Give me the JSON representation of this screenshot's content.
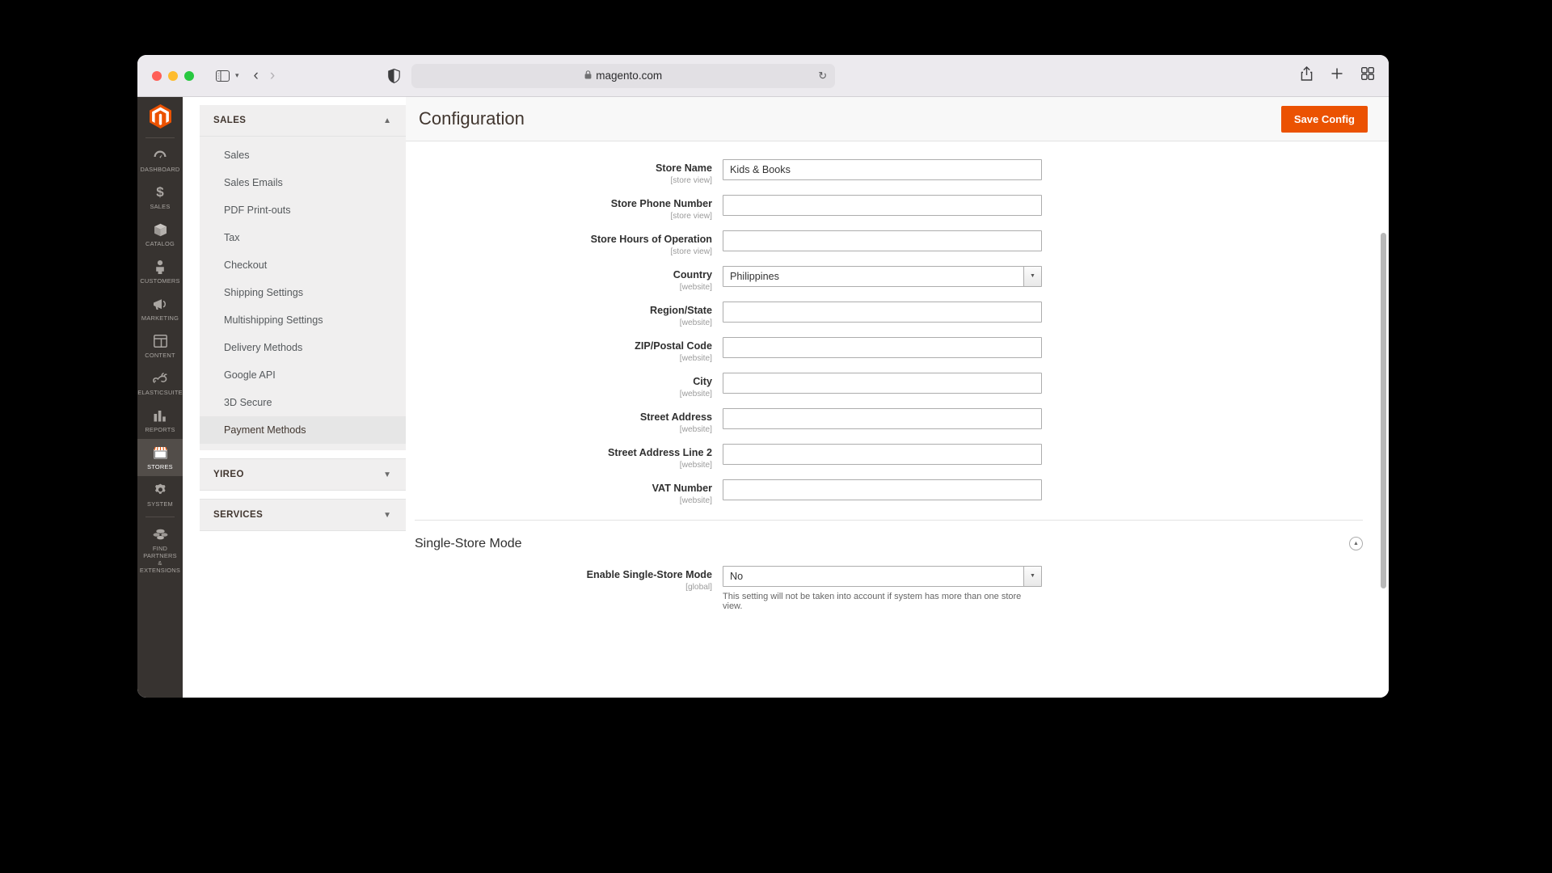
{
  "browser": {
    "url": "magento.com",
    "lock_icon": "lock-icon",
    "shield_icon": "shield-icon",
    "sidebar_icon": "sidebar-toggle-icon",
    "back_icon": "back-arrow-icon",
    "forward_icon": "forward-arrow-icon",
    "reload_icon": "reload-icon",
    "share_icon": "share-icon",
    "newtab_icon": "new-tab-icon",
    "tabgroup_icon": "tab-overview-icon"
  },
  "header": {
    "title": "Configuration",
    "save_label": "Save Config",
    "accent_color": "#eb5202"
  },
  "rail": {
    "logo_icon": "magento-logo-icon",
    "items": [
      {
        "label": "DASHBOARD",
        "icon": "dashboard-icon",
        "active": false
      },
      {
        "label": "SALES",
        "icon": "dollar-icon",
        "active": false
      },
      {
        "label": "CATALOG",
        "icon": "box-icon",
        "active": false
      },
      {
        "label": "CUSTOMERS",
        "icon": "person-icon",
        "active": false
      },
      {
        "label": "MARKETING",
        "icon": "megaphone-icon",
        "active": false
      },
      {
        "label": "CONTENT",
        "icon": "layout-icon",
        "active": false
      },
      {
        "label": "ELASTICSUITE",
        "icon": "rabbit-icon",
        "active": false
      },
      {
        "label": "REPORTS",
        "icon": "bar-chart-icon",
        "active": false
      },
      {
        "label": "STORES",
        "icon": "storefront-icon",
        "active": true
      },
      {
        "label": "SYSTEM",
        "icon": "gear-icon",
        "active": false
      }
    ],
    "footer_item": {
      "label": "FIND PARTNERS\n& EXTENSIONS",
      "icon": "partners-icon"
    }
  },
  "subnav": {
    "sections": [
      {
        "title": "SALES",
        "expanded": true,
        "chevron": "chevron-up-icon",
        "items": [
          {
            "label": "Sales",
            "active": false
          },
          {
            "label": "Sales Emails",
            "active": false
          },
          {
            "label": "PDF Print-outs",
            "active": false
          },
          {
            "label": "Tax",
            "active": false
          },
          {
            "label": "Checkout",
            "active": false
          },
          {
            "label": "Shipping Settings",
            "active": false
          },
          {
            "label": "Multishipping Settings",
            "active": false
          },
          {
            "label": "Delivery Methods",
            "active": false
          },
          {
            "label": "Google API",
            "active": false
          },
          {
            "label": "3D Secure",
            "active": false
          },
          {
            "label": "Payment Methods",
            "active": true
          }
        ]
      },
      {
        "title": "YIREO",
        "expanded": false,
        "chevron": "chevron-down-icon",
        "items": []
      },
      {
        "title": "SERVICES",
        "expanded": false,
        "chevron": "chevron-down-icon",
        "items": []
      }
    ]
  },
  "form": {
    "fields": [
      {
        "label": "Store Name",
        "scope": "[store view]",
        "type": "text",
        "value": "Kids & Books"
      },
      {
        "label": "Store Phone Number",
        "scope": "[store view]",
        "type": "text",
        "value": ""
      },
      {
        "label": "Store Hours of Operation",
        "scope": "[store view]",
        "type": "text",
        "value": ""
      },
      {
        "label": "Country",
        "scope": "[website]",
        "type": "select",
        "value": "Philippines"
      },
      {
        "label": "Region/State",
        "scope": "[website]",
        "type": "text",
        "value": ""
      },
      {
        "label": "ZIP/Postal Code",
        "scope": "[website]",
        "type": "text",
        "value": ""
      },
      {
        "label": "City",
        "scope": "[website]",
        "type": "text",
        "value": ""
      },
      {
        "label": "Street Address",
        "scope": "[website]",
        "type": "text",
        "value": ""
      },
      {
        "label": "Street Address Line 2",
        "scope": "[website]",
        "type": "text",
        "value": ""
      },
      {
        "label": "VAT Number",
        "scope": "[website]",
        "type": "text",
        "value": ""
      }
    ]
  },
  "single_store_mode": {
    "section_title": "Single-Store Mode",
    "collapse_icon": "chevron-up-circle-icon",
    "field": {
      "label": "Enable Single-Store Mode",
      "scope": "[global]",
      "value": "No",
      "note": "This setting will not be taken into account if system has more than one store view."
    }
  }
}
